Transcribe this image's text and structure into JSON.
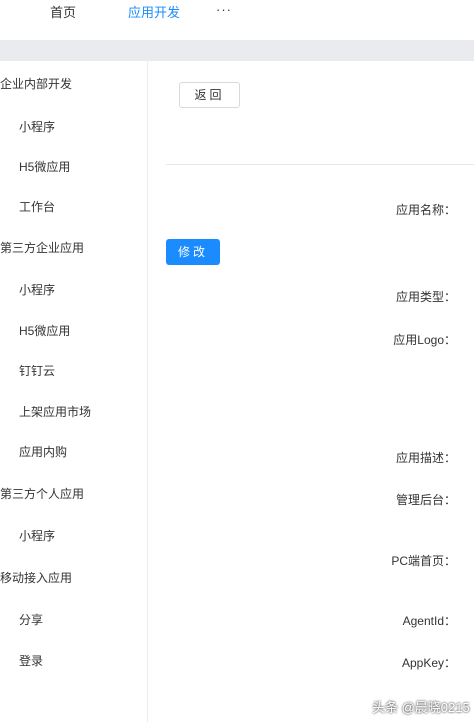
{
  "topnav": {
    "items": [
      {
        "label": "首页"
      },
      {
        "label": "应用开发"
      }
    ],
    "more": "···"
  },
  "sidebar": {
    "groups": [
      {
        "label": "企业内部开发",
        "items": [
          "小程序",
          "H5微应用",
          "工作台"
        ]
      },
      {
        "label": "第三方企业应用",
        "items": [
          "小程序",
          "H5微应用",
          "钉钉云",
          "上架应用市场",
          "应用内购"
        ]
      },
      {
        "label": "第三方个人应用",
        "items": [
          "小程序"
        ]
      },
      {
        "label": "移动接入应用",
        "items": [
          "分享",
          "登录"
        ]
      }
    ]
  },
  "main": {
    "back_button": "返回",
    "edit_button": "修改",
    "fields": [
      {
        "label": "应用名称："
      },
      {
        "label": "应用类型："
      },
      {
        "label": "应用Logo："
      },
      {
        "label": "应用描述："
      },
      {
        "label": "管理后台："
      },
      {
        "label": "PC端首页："
      },
      {
        "label": "AgentId："
      },
      {
        "label": "AppKey："
      }
    ]
  },
  "watermark": "头条 @晨晓0215",
  "colors": {
    "accent": "#1a8cff",
    "divider": "#e9ebee"
  }
}
